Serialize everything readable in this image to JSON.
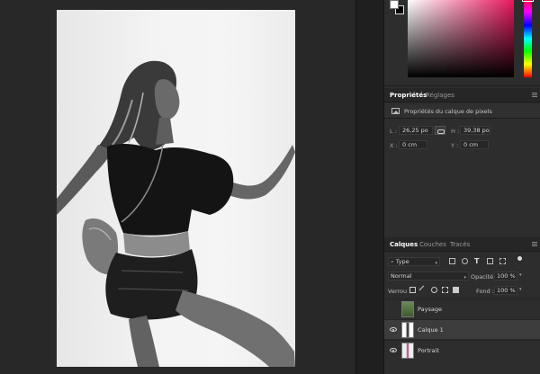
{
  "properties_panel": {
    "tabs": [
      "Propriétés",
      "Réglages"
    ],
    "title": "Propriétés du calque de pixels",
    "fields": {
      "width_label": "L :",
      "width_value": "26,25 po",
      "height_label": "H :",
      "height_value": "39,38 po",
      "x_label": "X :",
      "x_value": "0 cm",
      "y_label": "Y :",
      "y_value": "0 cm"
    }
  },
  "layers_panel": {
    "tabs": [
      "Calques",
      "Couches",
      "Tracés"
    ],
    "filter_placeholder": "Type",
    "blend_mode": "Normal",
    "opacity_label": "Opacité :",
    "opacity_value": "100 %",
    "lock_label": "Verrou :",
    "fill_label": "Fond :",
    "fill_value": "100 %",
    "layers": [
      {
        "name": "Paysage",
        "visible": false,
        "selected": false
      },
      {
        "name": "Calque 1",
        "visible": true,
        "selected": true
      },
      {
        "name": "Portrait",
        "visible": true,
        "selected": false
      }
    ]
  },
  "icons": {
    "filter_search": "search-icon",
    "image_filter": "image-icon",
    "adjust_filter": "adjustment-icon",
    "type_filter": "type-icon",
    "shape_filter": "shape-icon",
    "smart_filter": "smart-object-icon",
    "link": "link-icon",
    "eye": "eye-icon"
  },
  "colors": {
    "panel_bg": "#2d2d2d",
    "canvas_bg": "#282828",
    "selected_row": "#3c3c3c",
    "hue_accent": "#e8175d"
  }
}
